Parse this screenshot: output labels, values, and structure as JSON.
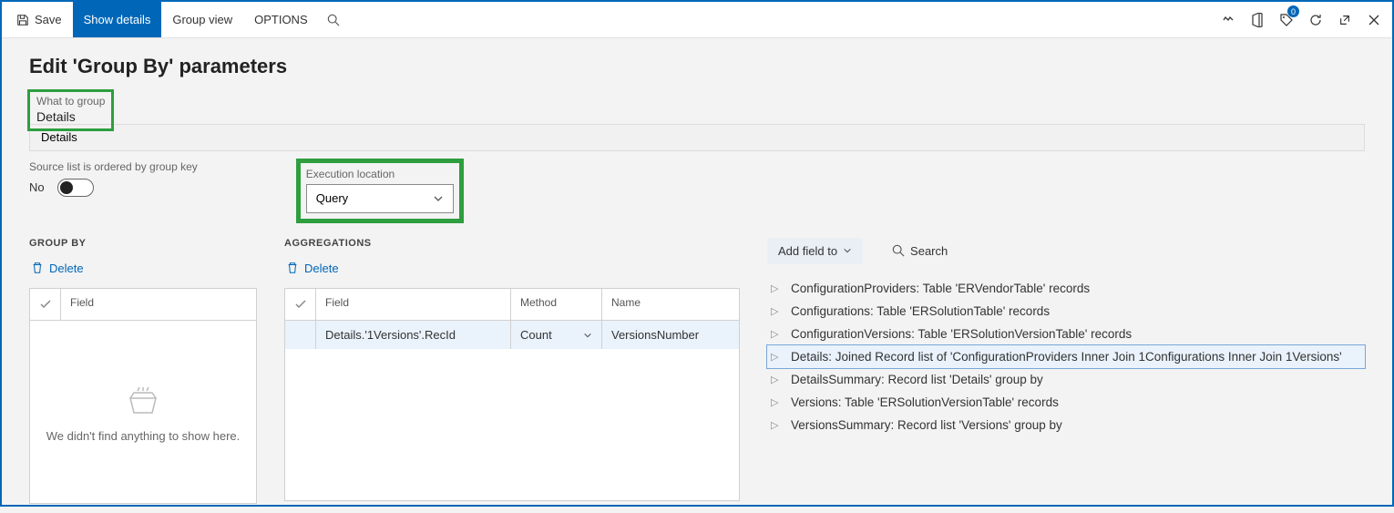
{
  "toolbar": {
    "save": "Save",
    "show_details": "Show details",
    "group_view": "Group view",
    "options": "OPTIONS",
    "badge": "0"
  },
  "page_title": "Edit 'Group By' parameters",
  "what_to_group": {
    "label": "What to group",
    "value": "Details"
  },
  "ordered": {
    "label": "Source list is ordered by group key",
    "value": "No"
  },
  "exec": {
    "label": "Execution location",
    "value": "Query"
  },
  "group_by": {
    "heading": "GROUP BY",
    "delete": "Delete",
    "field_header": "Field",
    "empty": "We didn't find anything to show here."
  },
  "aggregations": {
    "heading": "AGGREGATIONS",
    "delete": "Delete",
    "headers": {
      "field": "Field",
      "method": "Method",
      "name": "Name"
    },
    "rows": [
      {
        "field": "Details.'1Versions'.RecId",
        "method": "Count",
        "name": "VersionsNumber"
      }
    ]
  },
  "right": {
    "add_field": "Add field to",
    "search": "Search",
    "tree": [
      "ConfigurationProviders: Table 'ERVendorTable' records",
      "Configurations: Table 'ERSolutionTable' records",
      "ConfigurationVersions: Table 'ERSolutionVersionTable' records",
      "Details: Joined Record list of 'ConfigurationProviders Inner Join 1Configurations Inner Join 1Versions'",
      "DetailsSummary: Record list 'Details' group by",
      "Versions: Table 'ERSolutionVersionTable' records",
      "VersionsSummary: Record list 'Versions' group by"
    ],
    "selected_index": 3
  }
}
